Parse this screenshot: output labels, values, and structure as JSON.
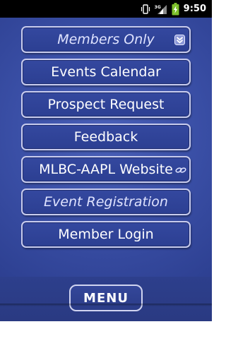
{
  "status_bar": {
    "time": "9:50",
    "network": "3G",
    "icons": [
      "vibrate-icon",
      "signal-icon",
      "battery-charging-icon"
    ]
  },
  "menu": {
    "items": [
      {
        "label": "Members Only",
        "style": "italic",
        "icon": "chevron-down-icon"
      },
      {
        "label": "Events Calendar",
        "style": "normal"
      },
      {
        "label": "Prospect Request",
        "style": "normal"
      },
      {
        "label": "Feedback",
        "style": "normal"
      },
      {
        "label": "MLBC-AAPL Website",
        "style": "normal",
        "icon": "link-icon"
      },
      {
        "label": "Event Registration",
        "style": "italic"
      },
      {
        "label": "Member Login",
        "style": "normal"
      }
    ]
  },
  "bottom": {
    "menu_button": "MENU"
  },
  "colors": {
    "background": "#3a4fa6",
    "button_border": "#c8ccee",
    "battery": "#7ec12c"
  }
}
